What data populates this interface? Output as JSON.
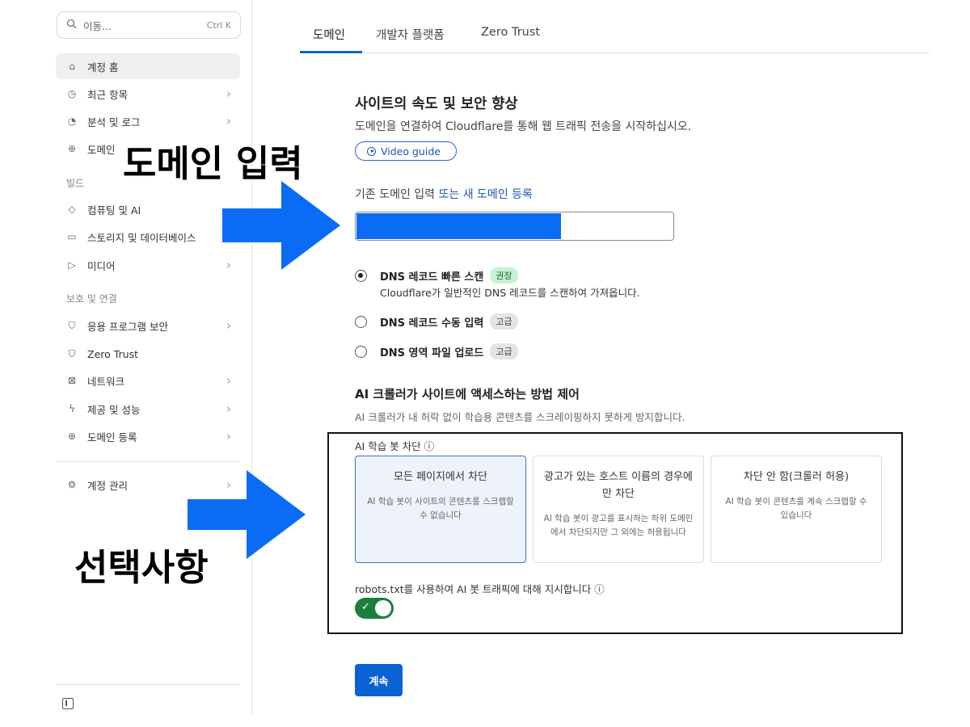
{
  "sidebar": {
    "search": {
      "placeholder": "이동...",
      "shortcut": "Ctrl K"
    },
    "items": [
      {
        "label": "계정 홈",
        "icon": "home-icon"
      },
      {
        "label": "최근 항목",
        "icon": "clock-icon"
      },
      {
        "label": "분석 및 로그",
        "icon": "chart-icon"
      },
      {
        "label": "도메인",
        "icon": "globe-icon"
      },
      {
        "label": "컴퓨팅 및 AI",
        "icon": "compute-icon"
      },
      {
        "label": "스토리지 및 데이터베이스",
        "icon": "storage-icon"
      },
      {
        "label": "미디어",
        "icon": "media-icon"
      },
      {
        "label": "응용 프로그램 보안",
        "icon": "shield-icon"
      },
      {
        "label": "Zero Trust",
        "icon": "zero-trust-icon"
      },
      {
        "label": "네트워크",
        "icon": "network-icon"
      },
      {
        "label": "제공 및 성능",
        "icon": "bolt-icon"
      },
      {
        "label": "도메인 등록",
        "icon": "globe-icon"
      },
      {
        "label": "계정 관리",
        "icon": "gear-icon"
      }
    ],
    "sections": {
      "build": "빌드",
      "protect": "보호 및 연결"
    }
  },
  "tabs": [
    "도메인",
    "개발자 플랫폼",
    "Zero Trust"
  ],
  "main": {
    "title": "사이트의 속도 및 보안 향상",
    "subtitle": "도메인을 연결하여 Cloudflare를 통해 웹 트래픽 전송을 시작하십시오.",
    "video_button": "Video guide",
    "domain_label": "기존 도메인 입력",
    "domain_link": "또는 새 도메인 등록",
    "domain_value": "",
    "dns_options": [
      {
        "label": "DNS 레코드 빠른 스캔",
        "badge": "권장",
        "checked": true,
        "desc": "Cloudflare가 일반적인 DNS 레코드를 스캔하여 가져옵니다."
      },
      {
        "label": "DNS 레코드 수동 입력",
        "badge": "고급",
        "checked": false
      },
      {
        "label": "DNS 영역 파일 업로드",
        "badge": "고급",
        "checked": false
      }
    ],
    "ai_title": "AI 크롤러가 사이트에 액세스하는 방법 제어",
    "ai_subtitle": "AI 크롤러가 내 허락 없이 학습용 콘텐츠를 스크레이핑하지 못하게 방지합니다.",
    "bot_label": "AI 학습 봇 차단 ⓘ",
    "cards": [
      {
        "title": "모든 페이지에서 차단",
        "desc": "AI 학습 봇이 사이트의 콘텐츠를 스크랩할 수 없습니다",
        "selected": true
      },
      {
        "title": "광고가 있는 호스트 이름의 경우에만 차단",
        "desc": "AI 학습 봇이 광고를 표시하는 하위 도메인에서 차단되지만 그 외에는 허용됩니다",
        "selected": false
      },
      {
        "title": "차단 안 함(크롤러 허용)",
        "desc": "AI 학습 봇이 콘텐츠를 계속 스크랩할 수 있습니다",
        "selected": false
      }
    ],
    "robots_label": "robots.txt를 사용하여 AI 봇 트래픽에 대해 지시합니다 ⓘ",
    "robots_enabled": true,
    "continue_button": "계속"
  },
  "annotations": {
    "domain_input": "도메인 입력",
    "optional": "선택사항",
    "arrow_color": "#0a6cf5"
  },
  "colors": {
    "accent": "#0a62d5",
    "toggle_on": "#1a7f3c"
  }
}
